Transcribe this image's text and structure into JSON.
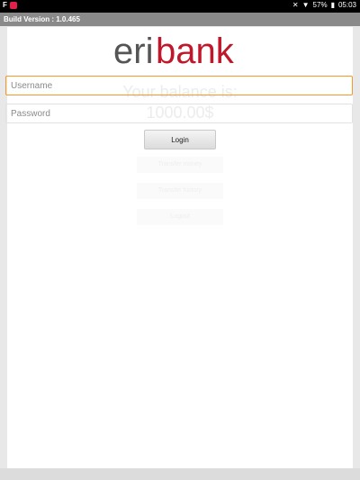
{
  "status_bar": {
    "left_icons": [
      "flipboard-icon",
      "notification-icon"
    ],
    "battery": "57%",
    "time": "05:03"
  },
  "build_version": "Build Version : 1.0.465",
  "logo": {
    "part1": "eri",
    "part2": "bank",
    "color1": "#555555",
    "color2": "#c0182b"
  },
  "background_ghost": {
    "title": "Your balance is:",
    "amount": "1000.00$",
    "buttons": [
      "Transfer money",
      "Transfer history",
      "Logout"
    ]
  },
  "login_form": {
    "username_placeholder": "Username",
    "password_placeholder": "Password",
    "login_label": "Login"
  },
  "colors": {
    "focus": "#f39a2b"
  }
}
